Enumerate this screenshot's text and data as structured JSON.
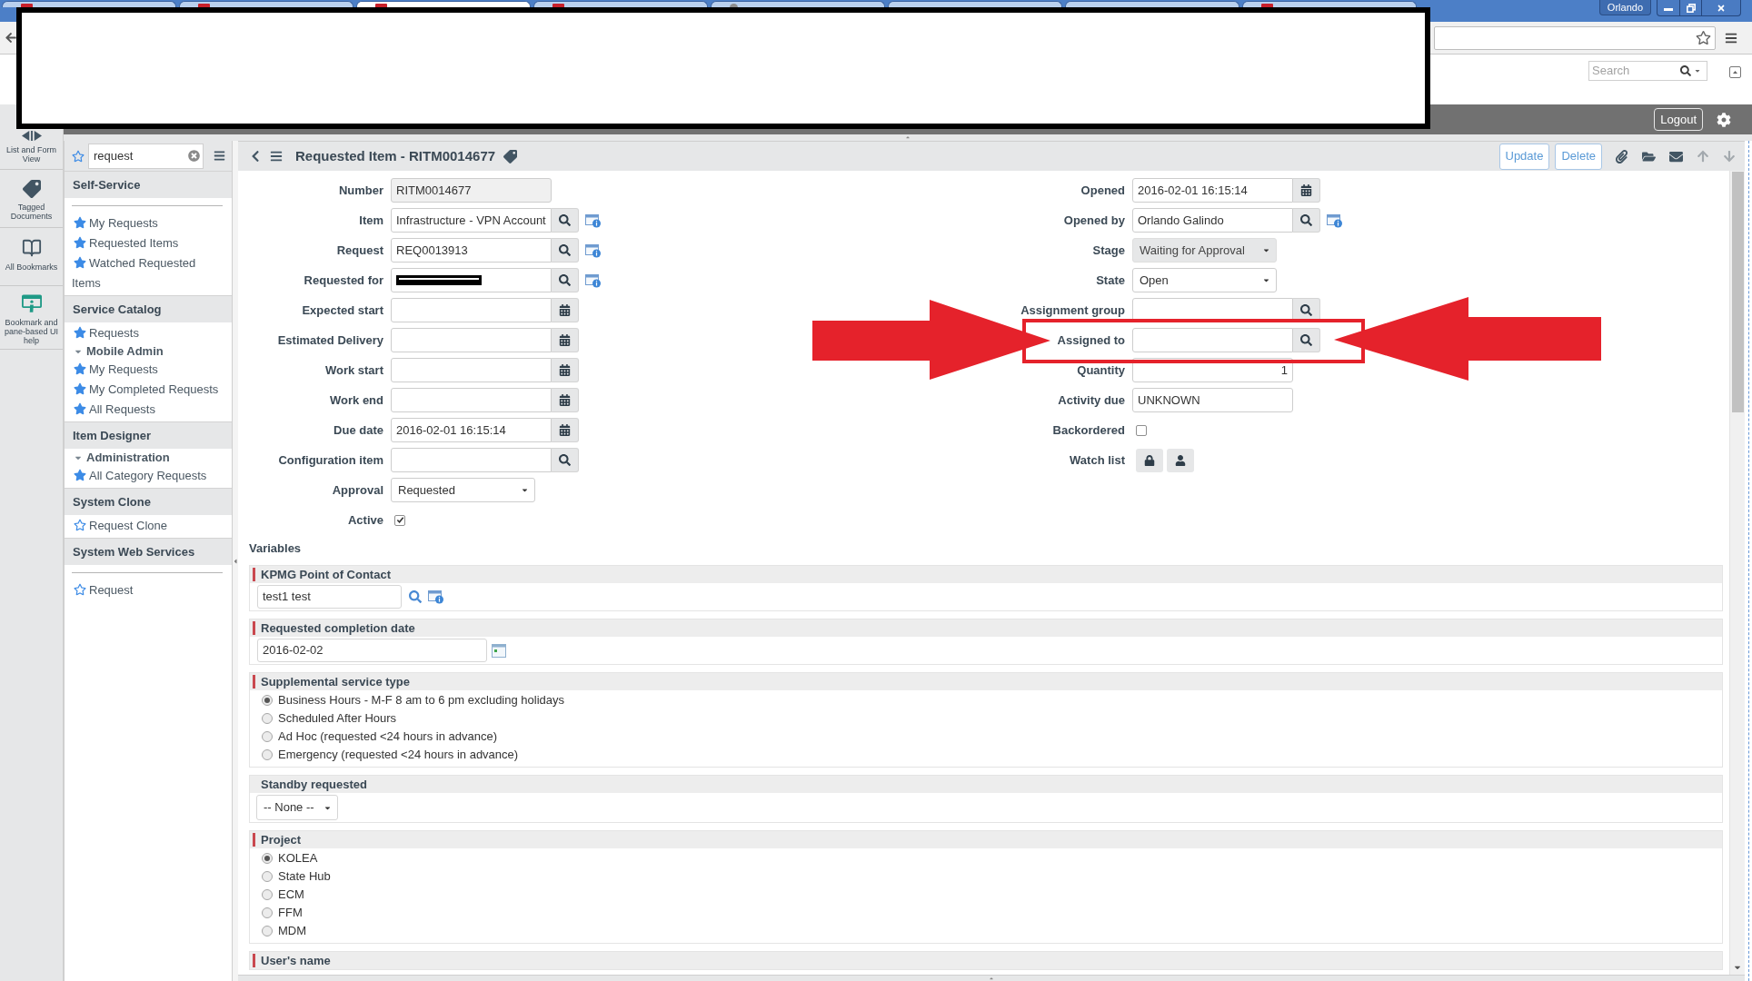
{
  "browser": {
    "tabs": [
      {
        "kind": "page",
        "selected": false
      },
      {
        "kind": "page",
        "selected": false
      },
      {
        "kind": "page",
        "selected": true
      },
      {
        "kind": "page",
        "selected": false
      },
      {
        "kind": "globe",
        "selected": false
      },
      {
        "kind": "blank",
        "selected": false
      },
      {
        "kind": "blank",
        "selected": false
      },
      {
        "kind": "page",
        "selected": false
      }
    ],
    "user": "Orlando"
  },
  "banner": {
    "search": {
      "placeholder": "Search"
    },
    "logout": "Logout"
  },
  "rail": [
    {
      "label": "List and Form View"
    },
    {
      "label": "Tagged Documents"
    },
    {
      "label": "All Bookmarks"
    },
    {
      "label": "Bookmark and pane-based UI help"
    }
  ],
  "navigator": {
    "filter": {
      "value": "request"
    },
    "sections": [
      {
        "title": "Self-Service",
        "divider": true,
        "items": [
          {
            "kind": "link",
            "label": "My Requests",
            "starred": true
          },
          {
            "kind": "link",
            "label": "Requested Items",
            "starred": true
          },
          {
            "kind": "link",
            "label": "Watched Requested Items",
            "starred": true
          }
        ]
      },
      {
        "title": "Service Catalog",
        "divider": false,
        "items": [
          {
            "kind": "link",
            "label": "Requests",
            "starred": true
          },
          {
            "kind": "group",
            "label": "Mobile Admin",
            "expanded": true,
            "children": [
              {
                "kind": "link",
                "label": "My Requests",
                "starred": true
              },
              {
                "kind": "link",
                "label": "My Completed Requests",
                "starred": true
              },
              {
                "kind": "link",
                "label": "All Requests",
                "starred": true
              }
            ]
          }
        ]
      },
      {
        "title": "Item Designer",
        "divider": false,
        "items": [
          {
            "kind": "group",
            "label": "Administration",
            "expanded": true,
            "children": [
              {
                "kind": "link",
                "label": "All Category Requests",
                "starred": true
              }
            ]
          }
        ]
      },
      {
        "title": "System Clone",
        "divider": false,
        "items": [
          {
            "kind": "link",
            "label": "Request Clone",
            "starred": false
          }
        ]
      },
      {
        "title": "System Web Services",
        "divider": true,
        "items": [
          {
            "kind": "link",
            "label": "Request",
            "starred": false
          }
        ]
      }
    ]
  },
  "form": {
    "title": "Requested Item - RITM0014677",
    "buttons": [
      "Update",
      "Delete"
    ],
    "left": [
      {
        "label": "Number",
        "kind": "readonly",
        "value": "RITM0014677"
      },
      {
        "label": "Item",
        "kind": "reference",
        "value": "Infrastructure - VPN Account",
        "info": true
      },
      {
        "label": "Request",
        "kind": "reference",
        "value": "REQ0013913",
        "info": true
      },
      {
        "label": "Requested for",
        "kind": "reference",
        "redacted": true,
        "info": true
      },
      {
        "label": "Expected start",
        "kind": "date"
      },
      {
        "label": "Estimated Delivery",
        "kind": "date"
      },
      {
        "label": "Work start",
        "kind": "date"
      },
      {
        "label": "Work end",
        "kind": "date"
      },
      {
        "label": "Due date",
        "kind": "date",
        "value": "2016-02-01 16:15:14"
      },
      {
        "label": "Configuration item",
        "kind": "reference",
        "info": false
      },
      {
        "label": "Approval",
        "kind": "select",
        "value": "Requested",
        "disabled": false
      },
      {
        "label": "Active",
        "kind": "checkbox",
        "checked": true
      }
    ],
    "right": [
      {
        "label": "Opened",
        "kind": "date",
        "value": "2016-02-01 16:15:14"
      },
      {
        "label": "Opened by",
        "kind": "reference",
        "value": "Orlando Galindo",
        "info": true
      },
      {
        "label": "Stage",
        "kind": "select",
        "value": "Waiting for Approval",
        "disabled": true
      },
      {
        "label": "State",
        "kind": "select",
        "value": "Open",
        "disabled": false
      },
      {
        "label": "Assignment group",
        "kind": "reference",
        "info": false
      },
      {
        "label": "Assigned to",
        "kind": "reference",
        "info": false,
        "highlighted": true
      },
      {
        "label": "Quantity",
        "kind": "number",
        "value": "1"
      },
      {
        "label": "Activity due",
        "kind": "text",
        "value": "UNKNOWN"
      },
      {
        "label": "Backordered",
        "kind": "checkbox",
        "checked": false
      },
      {
        "label": "Watch list",
        "kind": "watchlist"
      }
    ]
  },
  "variables": {
    "title": "Variables",
    "sections": [
      {
        "title": "KPMG Point of Contact",
        "mandatory": true,
        "kind": "reference",
        "value": "test1 test"
      },
      {
        "title": "Requested completion date",
        "mandatory": true,
        "kind": "date",
        "value": "2016-02-02"
      },
      {
        "title": "Supplemental service type",
        "mandatory": true,
        "kind": "radio",
        "options": [
          {
            "label": "Business Hours - M-F 8 am to 6 pm excluding holidays",
            "selected": true
          },
          {
            "label": "Scheduled After Hours",
            "selected": false
          },
          {
            "label": "Ad Hoc (requested <24 hours in advance)",
            "selected": false
          },
          {
            "label": "Emergency (requested <24 hours in advance)",
            "selected": false
          }
        ]
      },
      {
        "title": "Standby requested",
        "mandatory": false,
        "kind": "select",
        "value": "-- None --"
      },
      {
        "title": "Project",
        "mandatory": true,
        "kind": "radio",
        "options": [
          {
            "label": "KOLEA",
            "selected": true
          },
          {
            "label": "State Hub",
            "selected": false
          },
          {
            "label": "ECM",
            "selected": false
          },
          {
            "label": "FFM",
            "selected": false
          },
          {
            "label": "MDM",
            "selected": false
          }
        ]
      },
      {
        "title": "User's name",
        "mandatory": true,
        "kind": "header"
      }
    ]
  }
}
